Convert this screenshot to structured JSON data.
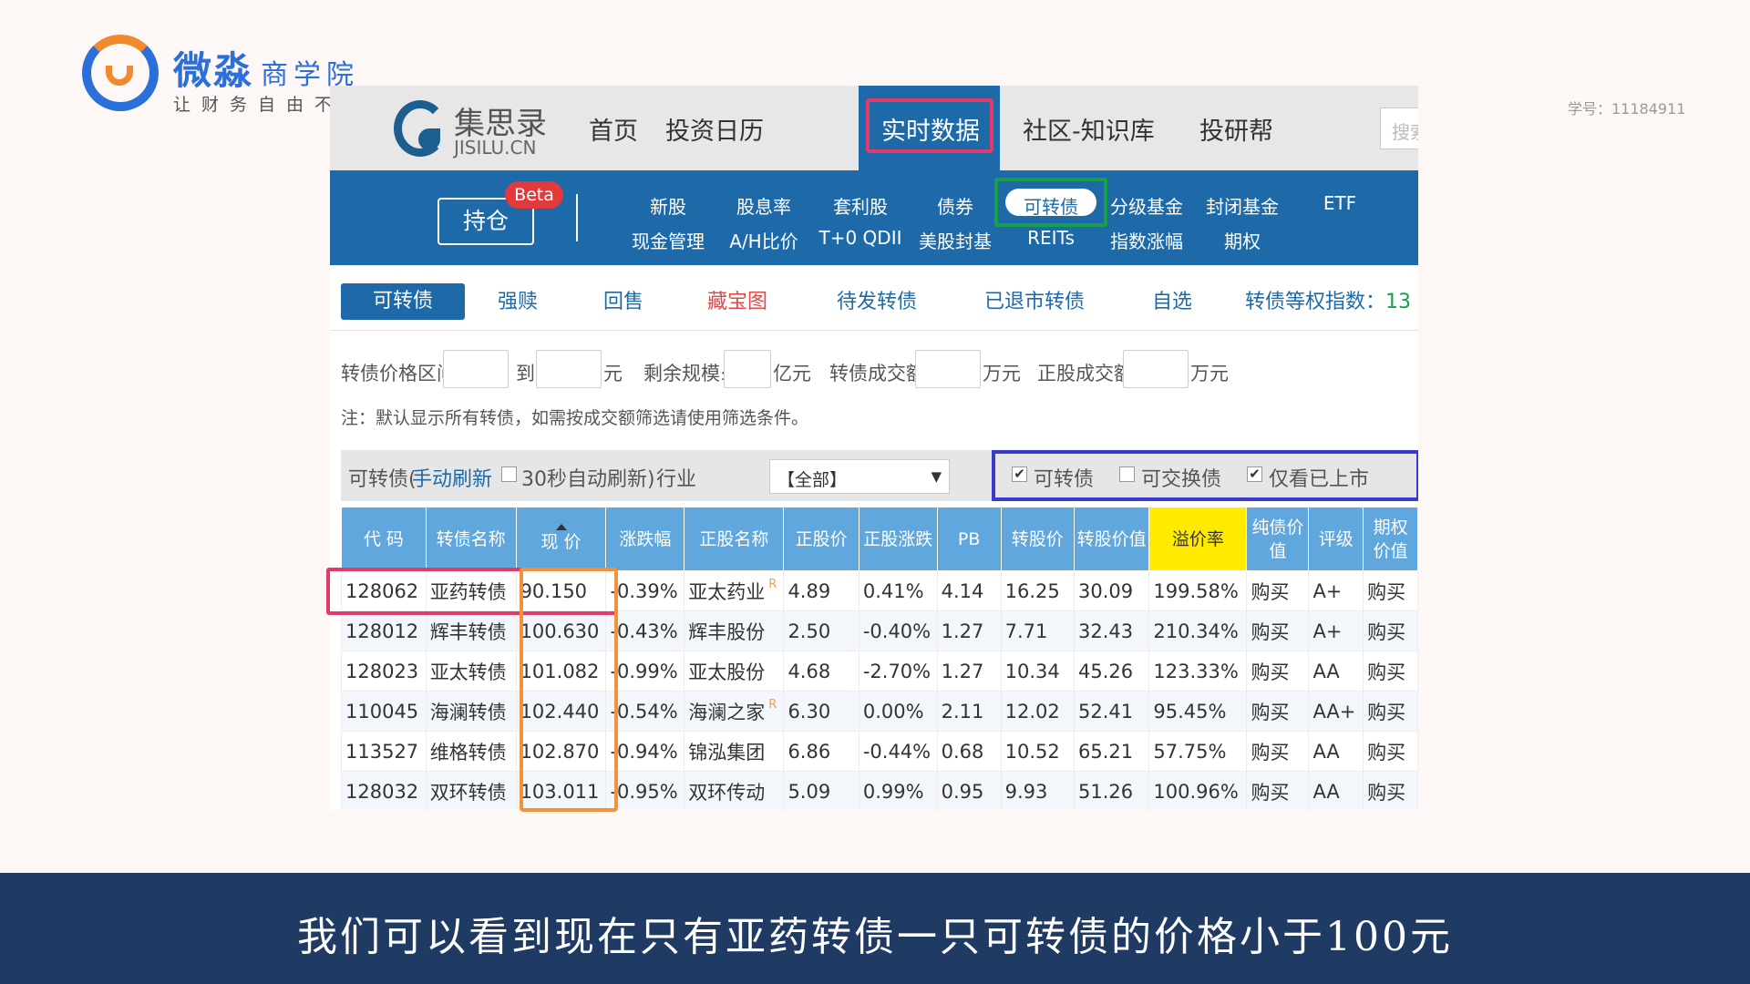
{
  "brand": {
    "name": "微淼",
    "name_suffix": "商学院",
    "slogan": "让财务自由不再难"
  },
  "student_id": "学号：11184911",
  "site": {
    "logo_cn": "集思录",
    "logo_en": "JISILU.CN",
    "nav": [
      "首页",
      "投资日历",
      "实时数据",
      "社区-知识库",
      "投研帮"
    ],
    "nav_active_index": 2,
    "search_placeholder": "搜索"
  },
  "subnav": {
    "holdings_label": "持仓",
    "beta_label": "Beta",
    "items_top": [
      "新股",
      "股息率",
      "套利股",
      "债券",
      "可转债",
      "分级基金",
      "封闭基金",
      "ETF"
    ],
    "items_bottom": [
      "现金管理",
      "A/H比价",
      "T+0 QDII",
      "美股封基",
      "REITs",
      "指数涨幅",
      "期权"
    ],
    "active_label": "可转债"
  },
  "tabs": {
    "items": [
      "可转债",
      "强赎",
      "回售",
      "藏宝图",
      "待发转债",
      "已退市转债",
      "自选"
    ],
    "index_label": "转债等权指数：",
    "index_value": "13"
  },
  "filters": {
    "price_range_label": "转债价格区间",
    "to_label": "到",
    "yuan_unit": "元",
    "remaining_scale_label": "剩余规模≤",
    "yi_yuan_unit": "亿元",
    "cb_turnover_label": "转债成交额",
    "wan_yuan_unit": "万元",
    "stock_turnover_label": "正股成交额",
    "wan_yuan_unit_2": "万元"
  },
  "note": "注：默认显示所有转债，如需按成交额筛选请使用筛选条件。",
  "toolbar": {
    "prefix": "可转债(",
    "manual_refresh": "手动刷新",
    "auto_refresh": "30秒自动刷新)",
    "industry_label": "行业",
    "industry_value": "【全部】",
    "chk_convertible": "可转债",
    "chk_exchangeable": "可交换债",
    "chk_listed_only": "仅看已上市",
    "chk_convertible_checked": "✔",
    "chk_exchangeable_checked": "",
    "chk_listed_only_checked": "✔",
    "auto_refresh_checked": ""
  },
  "table": {
    "headers": [
      "代 码",
      "转债名称",
      "现 价",
      "涨跌幅",
      "正股名称",
      "正股价",
      "正股涨跌",
      "PB",
      "转股价",
      "转股价值",
      "溢价率",
      "纯债价值",
      "评级",
      "期权价值"
    ],
    "rows": [
      {
        "code": "128062",
        "name": "亚药转债",
        "price": "90.150",
        "change": "-0.39%",
        "stock": "亚太药业",
        "stock_flag": "R",
        "stock_price": "4.89",
        "stock_change": "0.41%",
        "pb": "4.14",
        "conv_price": "16.25",
        "conv_value": "30.09",
        "premium": "199.58%",
        "bond_value": "购买",
        "rating": "A+",
        "option_value": "购买"
      },
      {
        "code": "128012",
        "name": "辉丰转债",
        "price": "100.630",
        "change": "-0.43%",
        "stock": "辉丰股份",
        "stock_flag": "",
        "stock_price": "2.50",
        "stock_change": "-0.40%",
        "pb": "1.27",
        "conv_price": "7.71",
        "conv_value": "32.43",
        "premium": "210.34%",
        "bond_value": "购买",
        "rating": "A+",
        "option_value": "购买"
      },
      {
        "code": "128023",
        "name": "亚太转债",
        "price": "101.082",
        "change": "-0.99%",
        "stock": "亚太股份",
        "stock_flag": "",
        "stock_price": "4.68",
        "stock_change": "-2.70%",
        "pb": "1.27",
        "conv_price": "10.34",
        "conv_value": "45.26",
        "premium": "123.33%",
        "bond_value": "购买",
        "rating": "AA",
        "option_value": "购买"
      },
      {
        "code": "110045",
        "name": "海澜转债",
        "price": "102.440",
        "change": "-0.54%",
        "stock": "海澜之家",
        "stock_flag": "R",
        "stock_price": "6.30",
        "stock_change": "0.00%",
        "pb": "2.11",
        "conv_price": "12.02",
        "conv_value": "52.41",
        "premium": "95.45%",
        "bond_value": "购买",
        "rating": "AA+",
        "option_value": "购买"
      },
      {
        "code": "113527",
        "name": "维格转债",
        "price": "102.870",
        "change": "-0.94%",
        "stock": "锦泓集团",
        "stock_flag": "",
        "stock_price": "6.86",
        "stock_change": "-0.44%",
        "pb": "0.68",
        "conv_price": "10.52",
        "conv_value": "65.21",
        "premium": "57.75%",
        "bond_value": "购买",
        "rating": "AA",
        "option_value": "购买"
      },
      {
        "code": "128032",
        "name": "双环转债",
        "price": "103.011",
        "change": "-0.95%",
        "stock": "双环传动",
        "stock_flag": "",
        "stock_price": "5.09",
        "stock_change": "0.99%",
        "pb": "0.95",
        "conv_price": "9.93",
        "conv_value": "51.26",
        "premium": "100.96%",
        "bond_value": "购买",
        "rating": "AA",
        "option_value": "购买"
      }
    ]
  },
  "caption": "我们可以看到现在只有亚药转债一只可转债的价格小于100元",
  "colors": {
    "site_blue": "#1e6aa8",
    "header_blue": "#5fa7dc",
    "premium_header": "#ffea00",
    "highlight_red": "#e23a6b",
    "highlight_green": "#18a048",
    "highlight_orange": "#f2923a",
    "highlight_navy": "#3a3acf",
    "caption_bg": "#1f3a63"
  }
}
